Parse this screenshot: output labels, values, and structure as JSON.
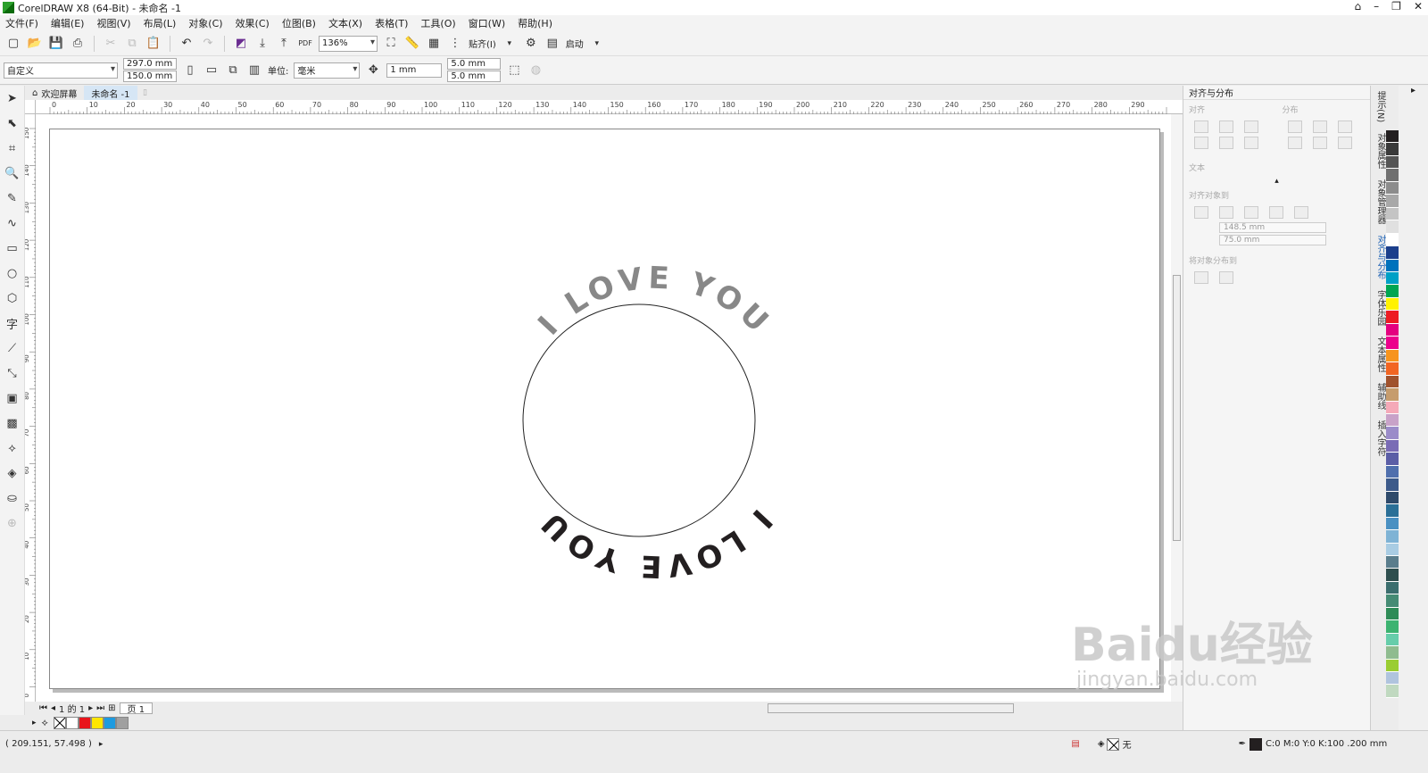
{
  "window": {
    "title": "CorelDRAW X8 (64-Bit) - 未命名 -1"
  },
  "menu": [
    "文件(F)",
    "编辑(E)",
    "视图(V)",
    "布局(L)",
    "对象(C)",
    "效果(C)",
    "位图(B)",
    "文本(X)",
    "表格(T)",
    "工具(O)",
    "窗口(W)",
    "帮助(H)"
  ],
  "toolbar": {
    "zoom": "136%",
    "snap_label": "贴齐(I)",
    "launch_label": "启动"
  },
  "propertybar": {
    "preset": "自定义",
    "width": "297.0 mm",
    "height": "150.0 mm",
    "unit_label": "单位:",
    "unit": "毫米",
    "nudge": "1 mm",
    "dup_x": "5.0 mm",
    "dup_y": "5.0 mm"
  },
  "tabs": {
    "welcome": "欢迎屏幕",
    "document": "未命名 -1"
  },
  "ruler": {
    "h_labels": [
      "0",
      "10",
      "20",
      "30",
      "40",
      "50",
      "60",
      "70",
      "80",
      "90",
      "100",
      "110",
      "120",
      "130",
      "140",
      "150",
      "160",
      "170",
      "180",
      "190",
      "200",
      "210",
      "220",
      "230",
      "240",
      "250",
      "260",
      "270",
      "280",
      "290"
    ],
    "h_unit": "毫米",
    "v_labels": [
      "150",
      "140",
      "130",
      "120",
      "110",
      "100",
      "90",
      "80",
      "70",
      "60",
      "50",
      "40",
      "30",
      "20",
      "10",
      "0"
    ]
  },
  "art": {
    "top_text": "I LOVE YOU",
    "bottom_text": "I LOVE YOU",
    "top_color": "#888888",
    "bottom_color": "#231f20"
  },
  "pager": {
    "text": "1 的 1",
    "page_tab": "页 1"
  },
  "status": {
    "coords": "( 209.151, 57.498 )",
    "fill_none": "无",
    "outline": "C:0 M:0 Y:0 K:100  .200 mm"
  },
  "dock": {
    "title": "对齐与分布",
    "section_align": "对齐",
    "section_distribute": "分布",
    "section_text": "文本",
    "section_align_to": "对齐对象到",
    "x_value": "148.5 mm",
    "y_value": "75.0 mm",
    "section_distribute_to": "将对象分布到"
  },
  "side_tabs": [
    "提示(N)",
    "对象属性",
    "对象管理器",
    "对齐与分布",
    "字体乐园",
    "文本属性",
    "辅助线",
    "插入字符"
  ],
  "palette_colors": [
    "#231f20",
    "#3a3a3a",
    "#555",
    "#707070",
    "#8c8c8c",
    "#a8a8a8",
    "#c4c4c4",
    "#e0e0e0",
    "#ffffff",
    "#1b3f8c",
    "#0072bc",
    "#00a0c6",
    "#00a651",
    "#fff200",
    "#ed1c24",
    "#e4007f",
    "#ec008c",
    "#f7941d",
    "#f26522",
    "#a0522d",
    "#c69c6d",
    "#f5a9b8",
    "#c8a2c8",
    "#9b8cc9",
    "#7a6cb5",
    "#5b5ea6",
    "#4f6fad",
    "#3c5a8a",
    "#2e4a6b",
    "#2a6f97",
    "#4a90c2",
    "#7fb3d5",
    "#a9cce3",
    "#5a7d8c",
    "#2f4f4f",
    "#3b6e6e",
    "#458b74",
    "#2e8b57",
    "#3cb371",
    "#66cdaa",
    "#8fbc8f",
    "#9acd32",
    "#b0c4de",
    "#c0d9c0"
  ],
  "quick_palette": [
    "#ffffff",
    "#e8141b",
    "#ffe600",
    "#1e9be0",
    "#a0a0a0"
  ],
  "watermark": {
    "brand": "Baidu经验",
    "url": "jingyan.baidu.com"
  }
}
